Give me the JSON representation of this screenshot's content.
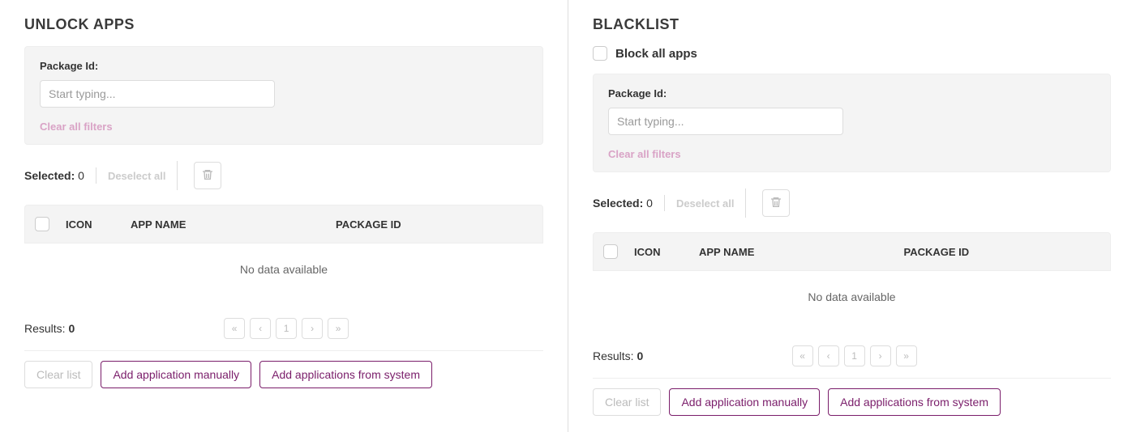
{
  "left": {
    "title": "UNLOCK APPS",
    "filter_label": "Package Id:",
    "filter_placeholder": "Start typing...",
    "clear_filters": "Clear all filters",
    "selected_label": "Selected:",
    "selected_count": "0",
    "deselect": "Deselect all",
    "columns": {
      "icon": "ICON",
      "name": "APP NAME",
      "pkg": "PACKAGE ID"
    },
    "empty": "No data available",
    "results_label": "Results:",
    "results_count": "0",
    "pager": {
      "first": "«",
      "prev": "‹",
      "page": "1",
      "next": "›",
      "last": "»"
    },
    "btn_clear": "Clear list",
    "btn_add_manual": "Add application manually",
    "btn_add_system": "Add applications from system"
  },
  "right": {
    "title": "BLACKLIST",
    "block_all": "Block all apps",
    "filter_label": "Package Id:",
    "filter_placeholder": "Start typing...",
    "clear_filters": "Clear all filters",
    "selected_label": "Selected:",
    "selected_count": "0",
    "deselect": "Deselect all",
    "columns": {
      "icon": "ICON",
      "name": "APP NAME",
      "pkg": "PACKAGE ID"
    },
    "empty": "No data available",
    "results_label": "Results:",
    "results_count": "0",
    "pager": {
      "first": "«",
      "prev": "‹",
      "page": "1",
      "next": "›",
      "last": "»"
    },
    "btn_clear": "Clear list",
    "btn_add_manual": "Add application manually",
    "btn_add_system": "Add applications from system"
  }
}
